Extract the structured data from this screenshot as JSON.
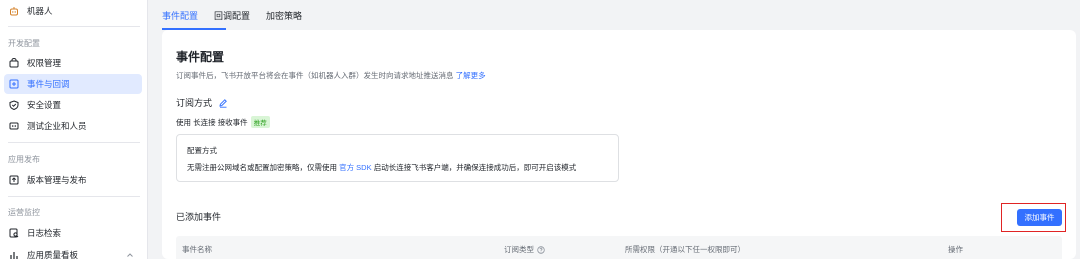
{
  "sidebar": {
    "top_item": {
      "label": "机器人",
      "icon": "robot-icon"
    },
    "sections": [
      {
        "title": "开发配置",
        "items": [
          {
            "label": "权限管理",
            "icon": "permission-icon",
            "active": false
          },
          {
            "label": "事件与回调",
            "icon": "event-icon",
            "active": true
          },
          {
            "label": "安全设置",
            "icon": "shield-icon",
            "active": false
          },
          {
            "label": "测试企业和人员",
            "icon": "test-icon",
            "active": false
          }
        ]
      },
      {
        "title": "应用发布",
        "items": [
          {
            "label": "版本管理与发布",
            "icon": "version-icon",
            "active": false
          }
        ]
      },
      {
        "title": "运营监控",
        "items": [
          {
            "label": "日志检索",
            "icon": "log-icon",
            "active": false
          },
          {
            "label": "应用质量看板",
            "icon": "chart-icon",
            "active": false
          }
        ]
      }
    ]
  },
  "tabs": [
    {
      "label": "事件配置",
      "active": true
    },
    {
      "label": "回调配置",
      "active": false
    },
    {
      "label": "加密策略",
      "active": false
    }
  ],
  "card": {
    "title": "事件配置",
    "description": "订阅事件后，飞书开放平台将会在事件（如机器人入群）发生时向请求地址推送消息",
    "learn_more": "了解更多",
    "subscription": {
      "title": "订阅方式",
      "use_prefix": "使用",
      "use_mode": "长连接",
      "use_suffix": "接收事件",
      "recommend_tag": "推荐"
    },
    "method": {
      "title": "配置方式",
      "desc_before": "无需注册公网域名或配置加密策略，仅需使用",
      "desc_link": "官方 SDK",
      "desc_after": "启动长连接飞书客户端，并确保连接成功后，即可开启该模式"
    },
    "added_events_title": "已添加事件",
    "add_button": "添加事件",
    "table": {
      "columns": [
        "事件名称",
        "订阅类型",
        "所需权限（开通以下任一权限即可）",
        "操作"
      ]
    }
  },
  "colors": {
    "accent": "#3370ff",
    "active_bg": "#e1eaff",
    "highlight_frame": "#e02424",
    "tag_bg": "#d9f5d6",
    "tag_text": "#2ea121"
  }
}
